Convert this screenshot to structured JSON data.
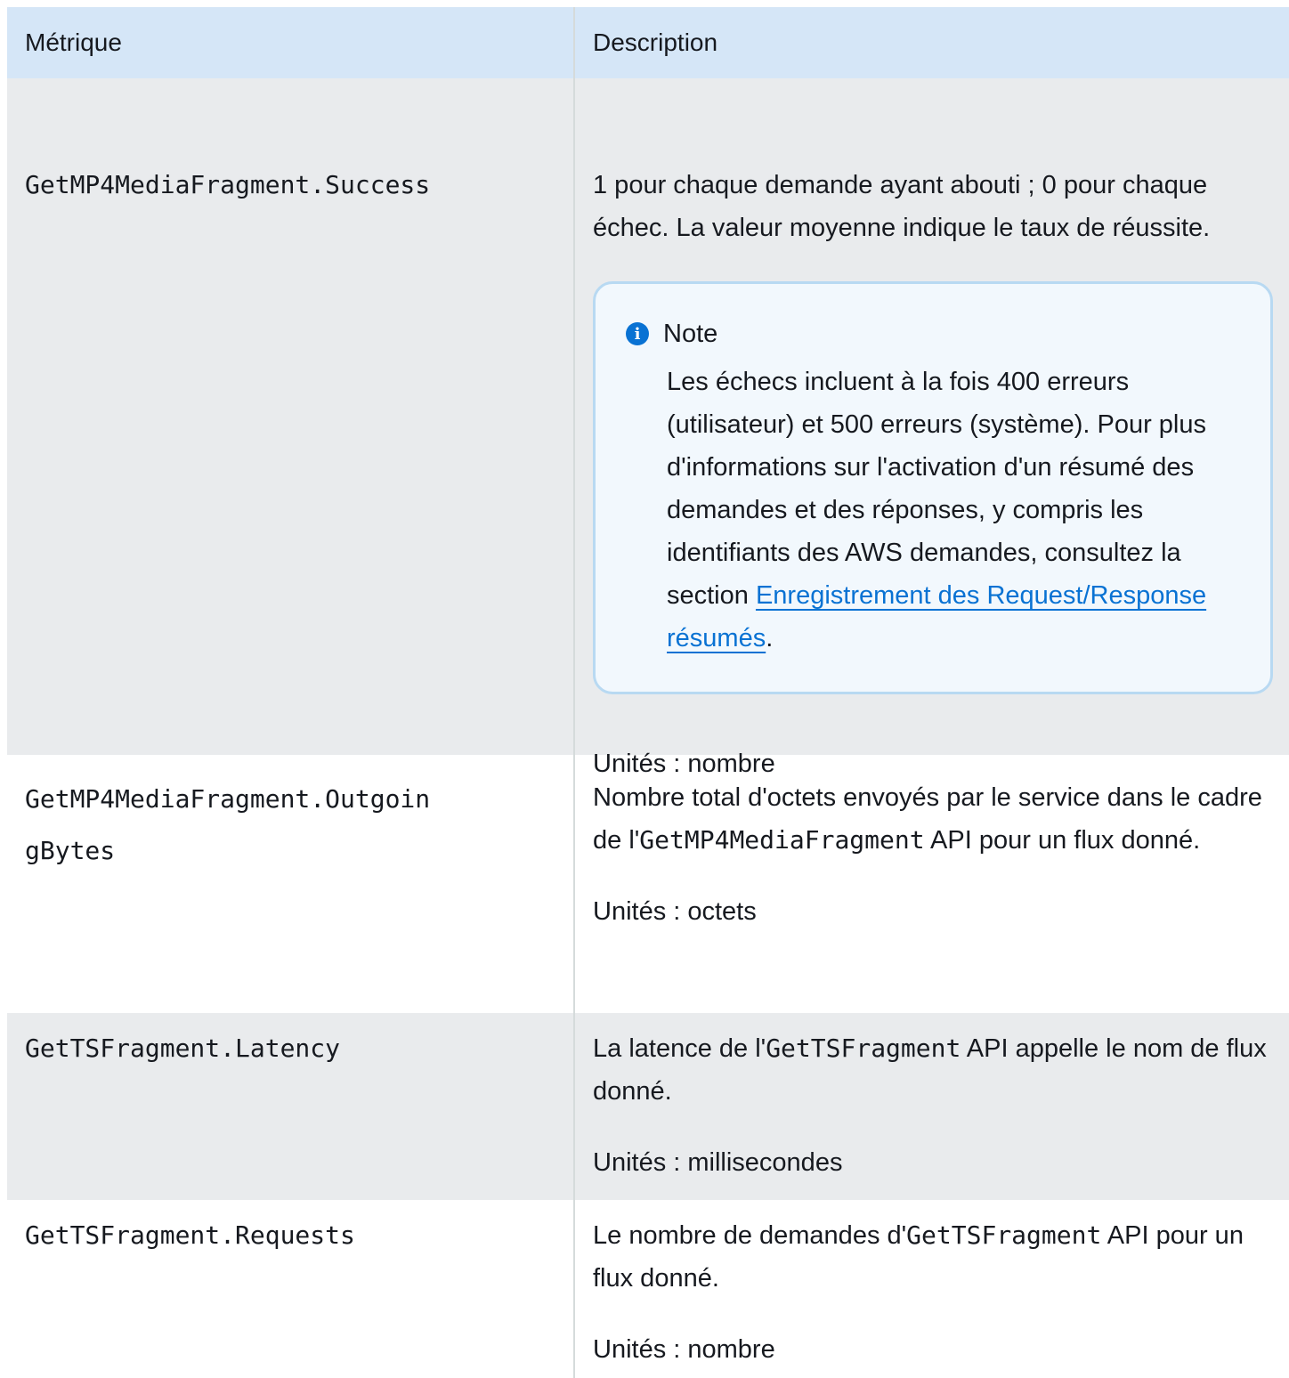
{
  "header": {
    "metric": "Métrique",
    "description": "Description"
  },
  "rows": [
    {
      "metric": "GetMP4MediaFragment.Success",
      "description": "1 pour chaque demande ayant abouti ; 0 pour chaque échec. La valeur moyenne indique le taux de réussite.",
      "note": {
        "title": "Note",
        "text_before_link": "Les échecs incluent à la fois 400 erreurs (utilisateur) et 500 erreurs (système). Pour plus d'informations sur l'activation d'un résumé des demandes et des réponses, y compris les identifiants des AWS demandes, consultez la section ",
        "link": "Enregistrement des Request/Response résumés",
        "text_after_link": "."
      },
      "units": "Unités : nombre"
    },
    {
      "metric_line1": "GetMP4MediaFragment.Outgoin",
      "metric_line2": "gBytes",
      "description_before": "Nombre total d'octets envoyés par le service dans le cadre de l'",
      "description_code": "GetMP4MediaFragment",
      "description_after": " API pour un flux donné.",
      "units": "Unités : octets"
    },
    {
      "metric": "GetTSFragment.Latency",
      "description_before": "La latence de l'",
      "description_code": "GetTSFragment",
      "description_after": " API appelle le nom de flux donné.",
      "units": "Unités : millisecondes"
    },
    {
      "metric": "GetTSFragment.Requests",
      "description_before": "Le nombre de demandes d'",
      "description_code": "GetTSFragment",
      "description_after": " API pour un flux donné.",
      "units": "Unités : nombre"
    }
  ],
  "colors": {
    "header_bg": "#d5e6f7",
    "gray_row": "#e9ebed",
    "link": "#0972d3",
    "note_border": "#b8d9f2"
  },
  "icons": [
    "info-icon"
  ]
}
